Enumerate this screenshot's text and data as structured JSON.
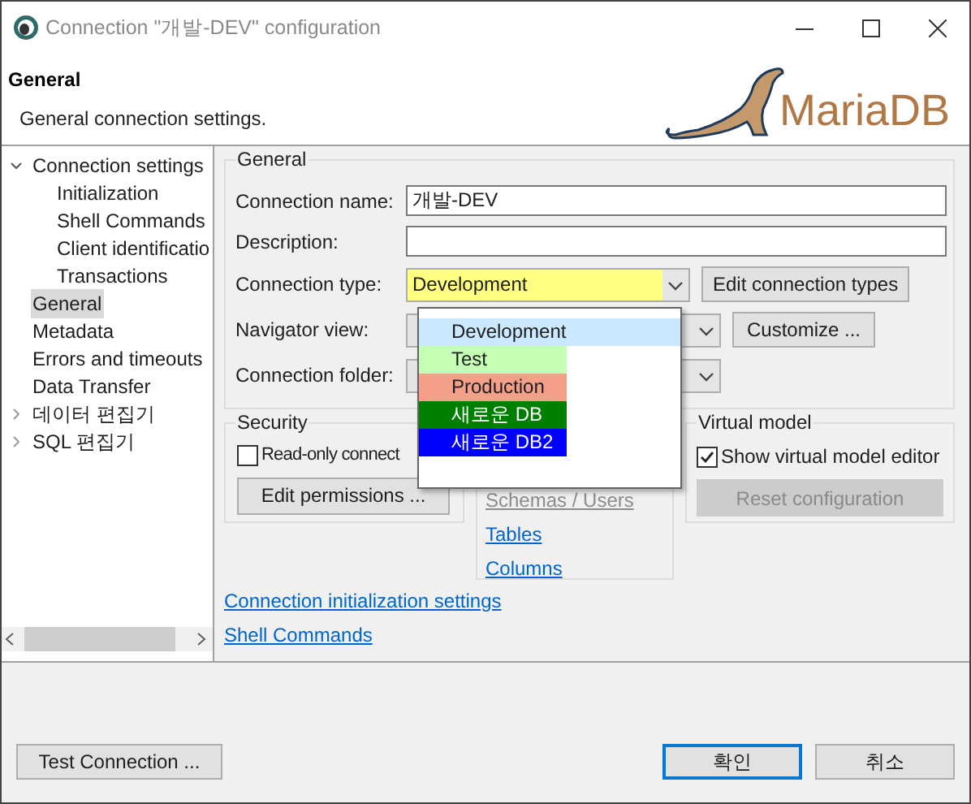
{
  "window": {
    "title": "Connection \"개발-DEV\" configuration"
  },
  "header": {
    "title": "General",
    "description": "General connection settings.",
    "logo_text": "MariaDB"
  },
  "tree": [
    {
      "label": "Connection settings",
      "expanded": true,
      "selected": false,
      "children": [
        {
          "label": "Initialization",
          "selected": false
        },
        {
          "label": "Shell Commands",
          "selected": false
        },
        {
          "label": "Client identificatio",
          "selected": false
        },
        {
          "label": "Transactions",
          "selected": false
        }
      ]
    },
    {
      "label": "General",
      "selected": true
    },
    {
      "label": "Metadata",
      "selected": false
    },
    {
      "label": "Errors and timeouts",
      "selected": false
    },
    {
      "label": "Data Transfer",
      "selected": false
    },
    {
      "label": "데이터 편집기",
      "expanded": false,
      "selected": false
    },
    {
      "label": "SQL 편집기",
      "expanded": false,
      "selected": false
    }
  ],
  "general_group": {
    "title": "General",
    "fields": [
      {
        "kind": "text",
        "label": "Connection name:",
        "value": "개발-DEV"
      },
      {
        "kind": "text",
        "label": "Description:"
      },
      {
        "kind": "combo",
        "label": "Connection type:",
        "value": "Development",
        "color": "#ffff80",
        "button": "Edit connection types"
      },
      {
        "kind": "combo",
        "label": "Navigator view:",
        "button": "Customize ..."
      },
      {
        "kind": "combo",
        "label": "Connection folder:"
      }
    ]
  },
  "type_dropdown": {
    "items": [
      {
        "label": "Development",
        "selected": true
      },
      {
        "label": "Test",
        "selected": false,
        "color": "#c4ffb5"
      },
      {
        "label": "Production",
        "selected": false,
        "color": "#f4a088"
      },
      {
        "label": "새로운 DB",
        "selected": false,
        "color": "#008000"
      },
      {
        "label": "새로운 DB2",
        "selected": false,
        "color": "#0000ff"
      }
    ]
  },
  "security": {
    "title": "Security",
    "checkbox": {
      "label": "Read-only connect",
      "checked": false
    },
    "button": "Edit permissions ..."
  },
  "object_links": [
    {
      "label": "Schemas / Users",
      "disabled": true
    },
    {
      "label": "Tables",
      "disabled": false
    },
    {
      "label": "Columns",
      "disabled": false
    }
  ],
  "virtual_model": {
    "title": "Virtual model",
    "checkbox": {
      "label": "Show virtual model editor",
      "checked": true
    },
    "button": {
      "label": "Reset configuration",
      "disabled": true
    }
  },
  "links": [
    "Connection initialization settings",
    "Shell Commands"
  ],
  "buttons": [
    {
      "label": "Test Connection ...",
      "default": false
    },
    {
      "label": "확인",
      "default": true
    },
    {
      "label": "취소",
      "default": false
    }
  ]
}
